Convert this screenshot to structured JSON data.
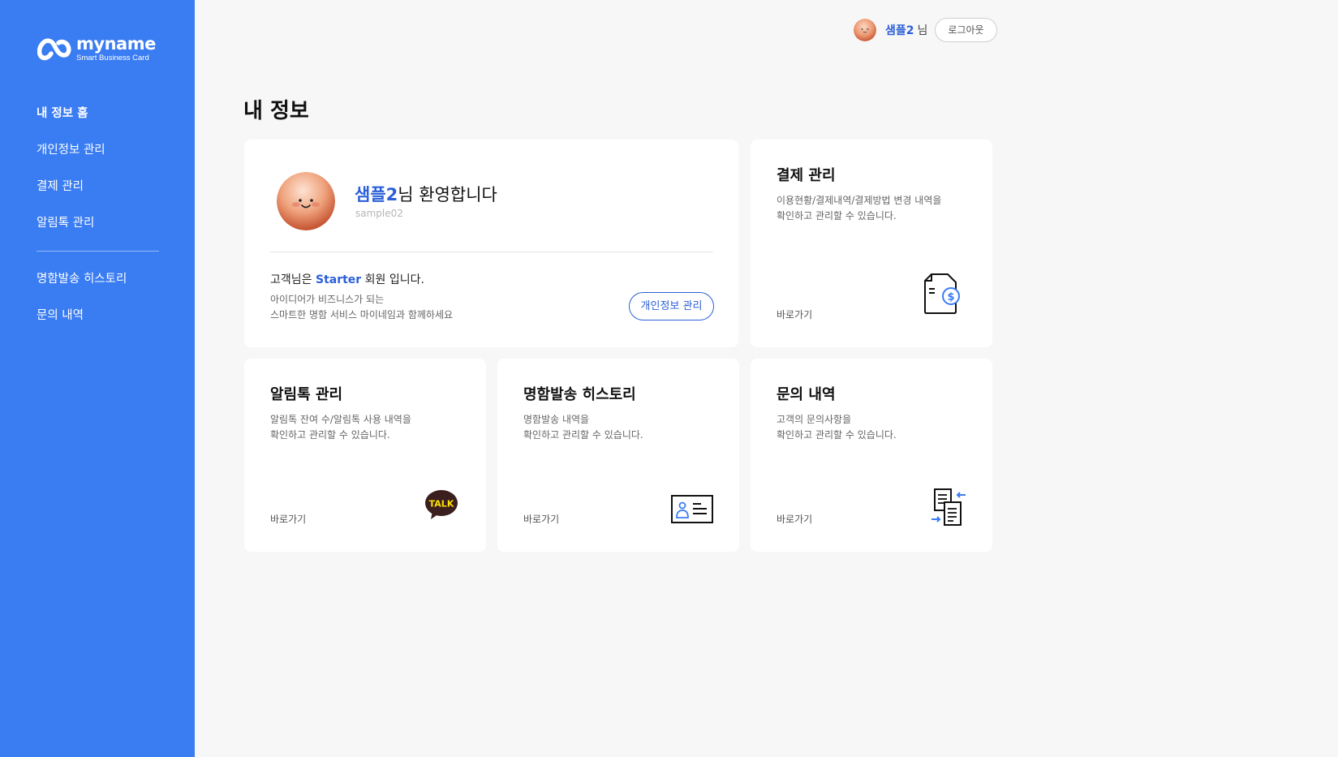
{
  "brand": {
    "name": "myname",
    "tagline": "Smart Business Card"
  },
  "sidebar": {
    "items": [
      {
        "label": "내 정보 홈",
        "active": true
      },
      {
        "label": "개인정보 관리"
      },
      {
        "label": "결제 관리"
      },
      {
        "label": "알림톡 관리"
      },
      {
        "label": "명함발송 히스토리"
      },
      {
        "label": "문의 내역"
      }
    ]
  },
  "header": {
    "user_name": "샘플2",
    "suffix": "님",
    "logout_label": "로그아웃"
  },
  "page": {
    "title": "내 정보"
  },
  "profile": {
    "name": "샘플2",
    "welcome_suffix": "님 환영합니다",
    "user_id": "sample02",
    "membership_prefix": "고객님은 ",
    "tier": "Starter",
    "membership_suffix": " 회원 입니다.",
    "desc_line1": "아이디어가 비즈니스가 되는",
    "desc_line2": "스마트한 명함 서비스 마이네임과 함께하세요",
    "manage_button": "개인정보 관리"
  },
  "cards": {
    "payment": {
      "title": "결제 관리",
      "desc_line1": "이용현황/결제내역/결제방법 변경 내역을",
      "desc_line2": "확인하고 관리할 수 있습니다.",
      "link": "바로가기",
      "icon": "invoice-dollar-icon"
    },
    "alimtalk": {
      "title": "알림톡 관리",
      "desc_line1": "알림톡 잔여 수/알림톡 사용 내역을",
      "desc_line2": "확인하고 관리할 수 있습니다.",
      "link": "바로가기",
      "icon": "kakao-talk-icon",
      "icon_text": "TALK"
    },
    "history": {
      "title": "명함발송 히스토리",
      "desc_line1": "명함발송 내역을",
      "desc_line2": "확인하고 관리할 수 있습니다.",
      "link": "바로가기",
      "icon": "business-card-icon"
    },
    "inquiry": {
      "title": "문의 내역",
      "desc_line1": "고객의 문의사항을",
      "desc_line2": "확인하고 관리할 수 있습니다.",
      "link": "바로가기",
      "icon": "documents-exchange-icon"
    }
  },
  "colors": {
    "sidebar": "#3a7cf2",
    "accent": "#2b5fd8",
    "background": "#f7f7f7",
    "kakao_yellow": "#fae100",
    "kakao_brown": "#3b1e1e"
  }
}
